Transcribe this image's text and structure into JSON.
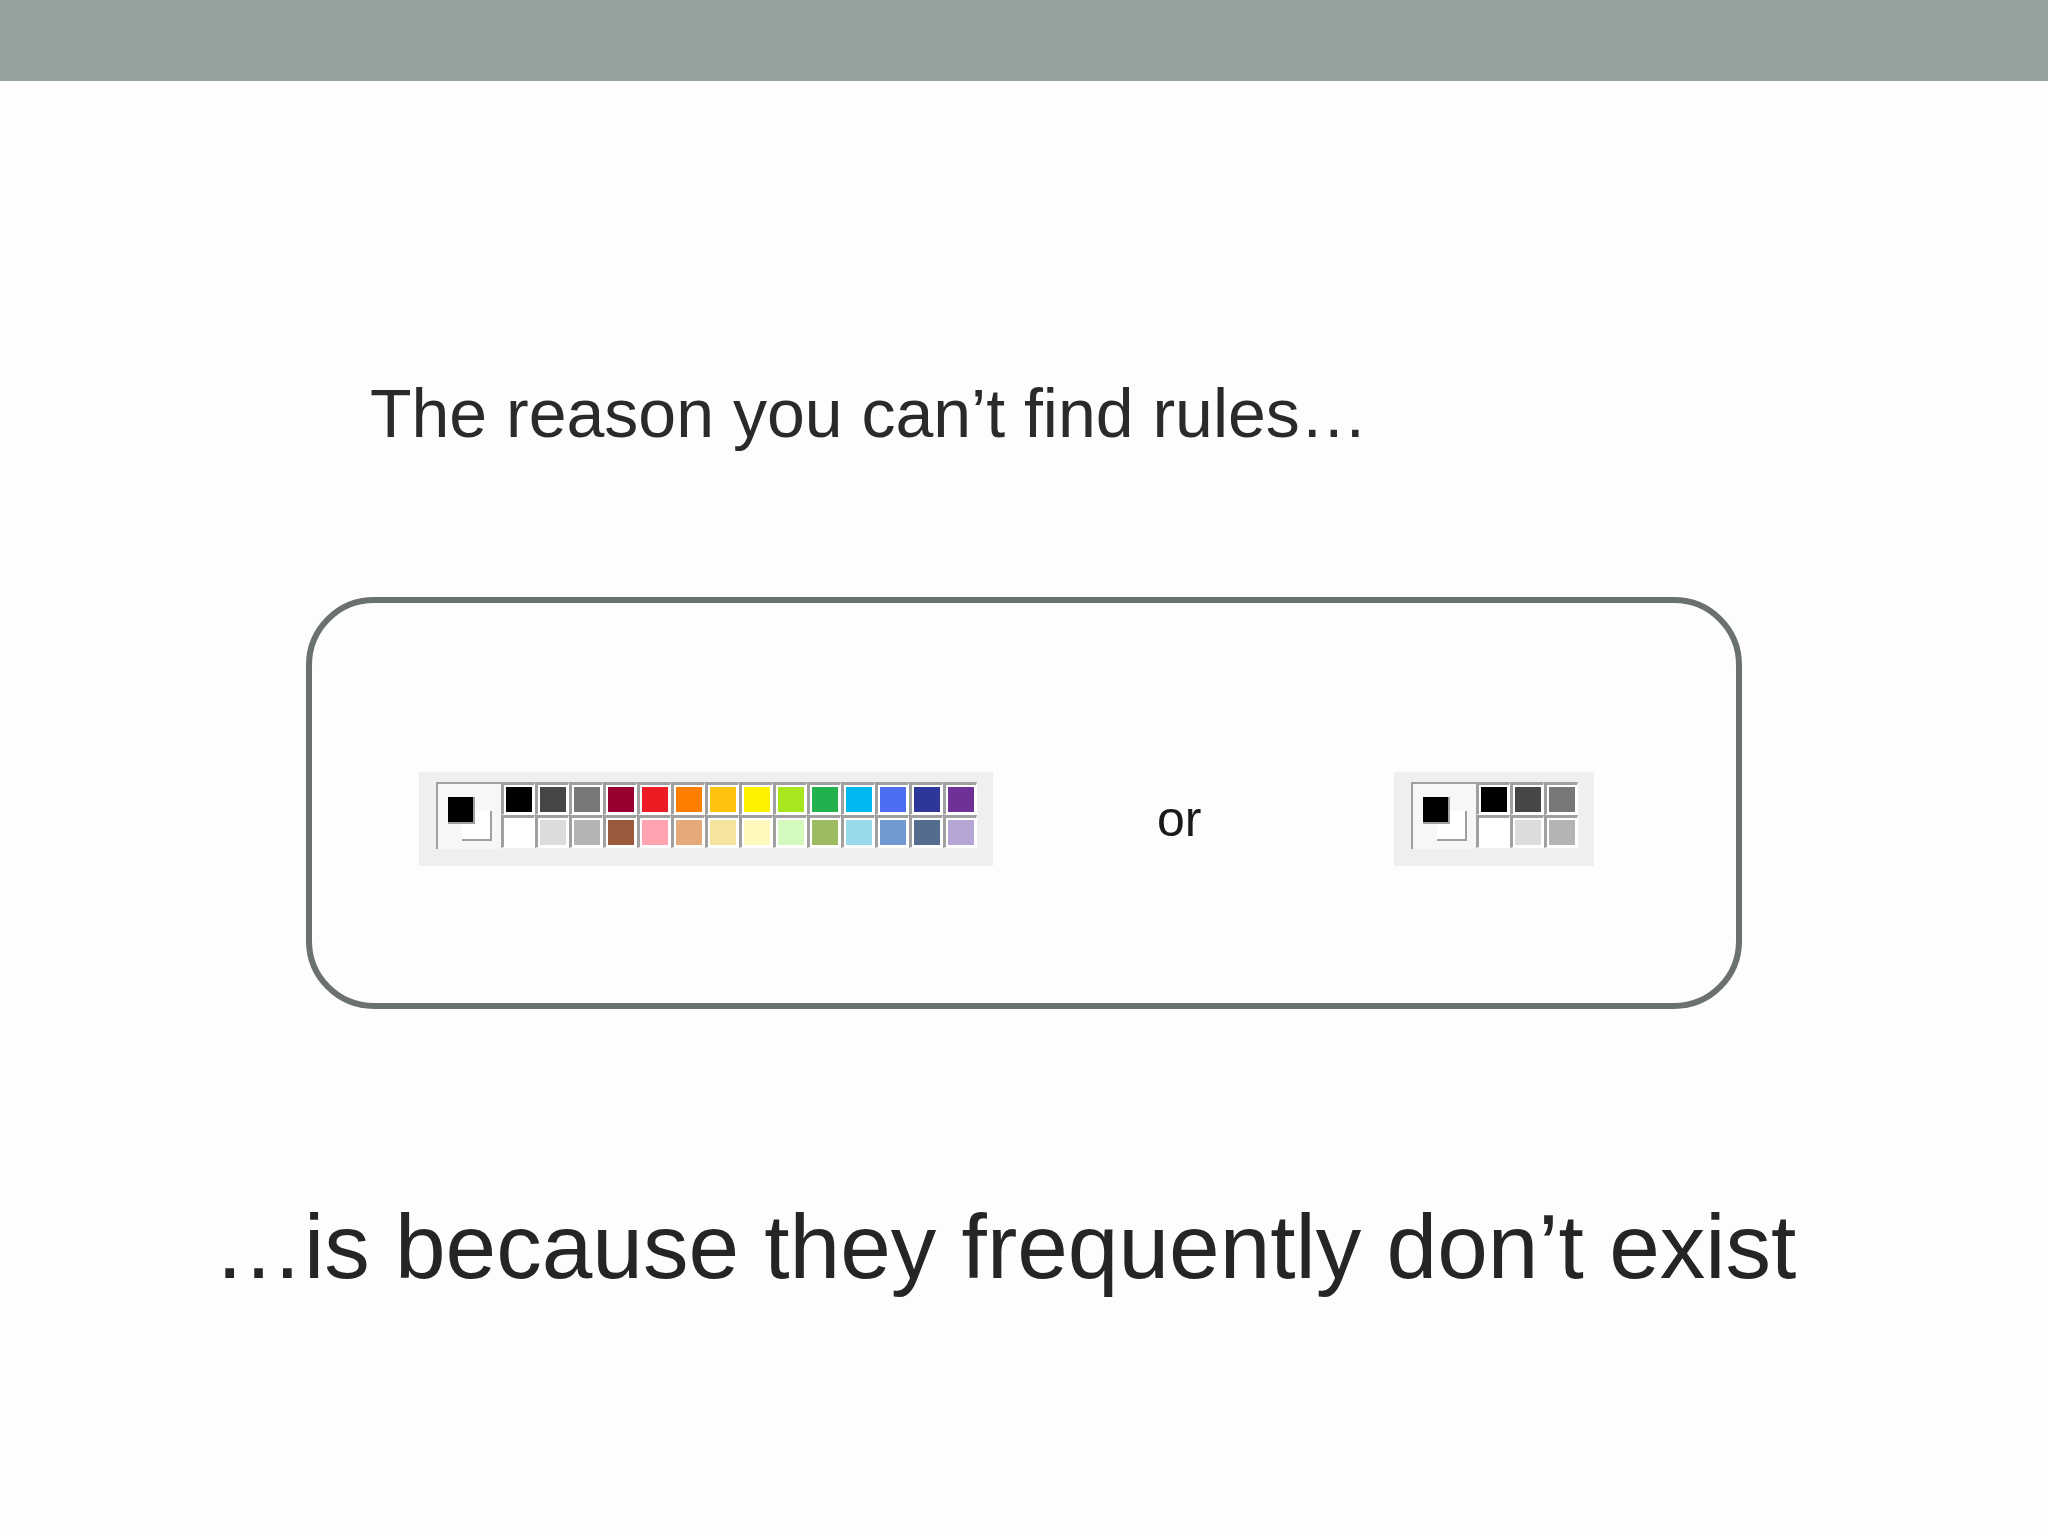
{
  "title": "The reason you can’t find rules…",
  "panel": {
    "palettes": [
      {
        "rows": [
          {
            "swatches": [
              {
                "color": "#000000"
              },
              {
                "color": "#464646"
              },
              {
                "color": "#787878"
              },
              {
                "color": "#990030"
              },
              {
                "color": "#ed1c24"
              },
              {
                "color": "#ff7e00"
              },
              {
                "color": "#ffc20e"
              },
              {
                "color": "#fff200"
              },
              {
                "color": "#a8e61d"
              },
              {
                "color": "#22b14c"
              },
              {
                "color": "#00b7ef"
              },
              {
                "color": "#4d6df3"
              },
              {
                "color": "#2f3699"
              },
              {
                "color": "#6f3198"
              }
            ]
          },
          {
            "swatches": [
              {
                "color": "#ffffff"
              },
              {
                "color": "#dcdcdc"
              },
              {
                "color": "#b4b4b4"
              },
              {
                "color": "#9c5a3c"
              },
              {
                "color": "#ffa3b1"
              },
              {
                "color": "#e5aa7a"
              },
              {
                "color": "#f5e49c"
              },
              {
                "color": "#fff9bd"
              },
              {
                "color": "#d3f9bc"
              },
              {
                "color": "#9dbb61"
              },
              {
                "color": "#99d9ea"
              },
              {
                "color": "#709ad1"
              },
              {
                "color": "#546d8e"
              },
              {
                "color": "#b5a5d5"
              }
            ]
          }
        ]
      },
      {
        "rows": [
          {
            "swatches": [
              {
                "color": "#000000"
              },
              {
                "color": "#464646"
              },
              {
                "color": "#787878"
              }
            ]
          },
          {
            "swatches": [
              {
                "color": "#ffffff"
              },
              {
                "color": "#dcdcdc"
              },
              {
                "color": "#b4b4b4"
              }
            ]
          }
        ]
      }
    ],
    "separator": "or"
  },
  "caption": "…is because they frequently don’t exist"
}
